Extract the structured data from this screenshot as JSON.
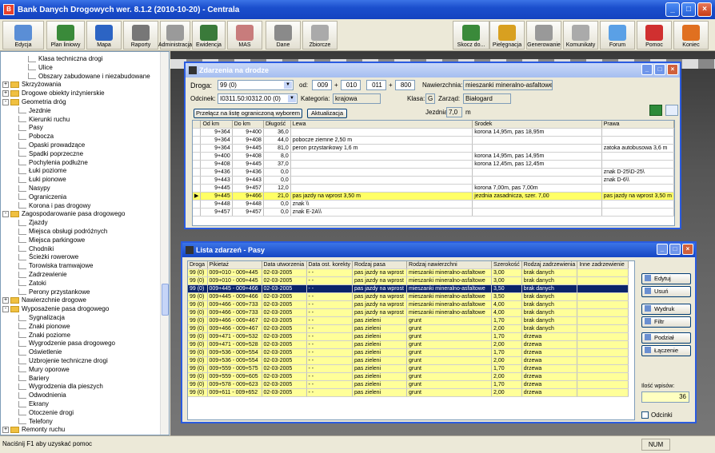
{
  "app": {
    "title": "Bank Danych Drogowych wer. 8.1.2 (2010-10-20) - Centrala",
    "icon": "app-logo-icon"
  },
  "toolbar": [
    {
      "label": "Edycja",
      "icon": "edit-icon",
      "color": "#5a8ed6"
    },
    {
      "label": "Plan liniowy",
      "icon": "linear-plan-icon",
      "color": "#3a8a3a"
    },
    {
      "label": "Mapa",
      "icon": "map-icon",
      "color": "#2c64c4"
    },
    {
      "label": "Raporty",
      "icon": "printer-icon",
      "color": "#777"
    },
    {
      "label": "Administracja",
      "icon": "admin-icon",
      "color": "#9a9a9a"
    },
    {
      "label": "Ewidencja",
      "icon": "registry-icon",
      "color": "#3a7a3a"
    },
    {
      "label": "MAS",
      "icon": "mas-icon",
      "color": "#c87c7c"
    },
    {
      "label": "Dane",
      "icon": "data-icon",
      "color": "#8a8a8a"
    },
    {
      "label": "Zbiorcze",
      "icon": "summary-icon",
      "color": "#aaa"
    },
    {
      "label": "Skocz do...",
      "icon": "jump-icon",
      "color": "#3a8a3a"
    },
    {
      "label": "Pielęgnacja",
      "icon": "maintenance-icon",
      "color": "#d8a020"
    },
    {
      "label": "Generowanie",
      "icon": "generate-icon",
      "color": "#999"
    },
    {
      "label": "Komunikaty",
      "icon": "messages-icon",
      "color": "#aaa"
    },
    {
      "label": "Forum",
      "icon": "forum-icon",
      "color": "#5aa0e6"
    },
    {
      "label": "Pomoc",
      "icon": "help-icon",
      "color": "#d03030"
    },
    {
      "label": "Koniec",
      "icon": "exit-icon",
      "color": "#e07020"
    }
  ],
  "tree": [
    {
      "t": "Klasa techniczna drogi",
      "lvl": 2
    },
    {
      "t": "Ulice",
      "lvl": 2
    },
    {
      "t": "Obszary zabudowane i niezabudowane",
      "lvl": 2
    },
    {
      "t": "Skrzyżowania",
      "lvl": 0,
      "f": 1
    },
    {
      "t": "Drogowe obiekty inżynierskie",
      "lvl": 0,
      "f": 1
    },
    {
      "t": "Geometria dróg",
      "lvl": 0,
      "f": 1,
      "o": 1
    },
    {
      "t": "Jezdnie",
      "lvl": 1
    },
    {
      "t": "Kierunki ruchu",
      "lvl": 1
    },
    {
      "t": "Pasy",
      "lvl": 1
    },
    {
      "t": "Pobocza",
      "lvl": 1
    },
    {
      "t": "Opaski prowadzące",
      "lvl": 1
    },
    {
      "t": "Spadki poprzeczne",
      "lvl": 1
    },
    {
      "t": "Pochylenia podłużne",
      "lvl": 1
    },
    {
      "t": "Łuki poziome",
      "lvl": 1
    },
    {
      "t": "Łuki pionowe",
      "lvl": 1
    },
    {
      "t": "Nasypy",
      "lvl": 1
    },
    {
      "t": "Ograniczenia",
      "lvl": 1
    },
    {
      "t": "Korona i pas drogowy",
      "lvl": 1
    },
    {
      "t": "Zagospodarowanie pasa drogowego",
      "lvl": 0,
      "f": 1,
      "o": 1
    },
    {
      "t": "Zjazdy",
      "lvl": 1
    },
    {
      "t": "Miejsca obsługi podróżnych",
      "lvl": 1
    },
    {
      "t": "Miejsca parkingowe",
      "lvl": 1
    },
    {
      "t": "Chodniki",
      "lvl": 1
    },
    {
      "t": "Ścieżki rowerowe",
      "lvl": 1
    },
    {
      "t": "Torowiska tramwajowe",
      "lvl": 1
    },
    {
      "t": "Zadrzewienie",
      "lvl": 1
    },
    {
      "t": "Zatoki",
      "lvl": 1
    },
    {
      "t": "Perony przystankowe",
      "lvl": 1
    },
    {
      "t": "Nawierzchnie drogowe",
      "lvl": 0,
      "f": 1
    },
    {
      "t": "Wyposażenie pasa drogowego",
      "lvl": 0,
      "f": 1,
      "o": 1
    },
    {
      "t": "Sygnalizacja",
      "lvl": 1
    },
    {
      "t": "Znaki pionowe",
      "lvl": 1
    },
    {
      "t": "Znaki poziome",
      "lvl": 1
    },
    {
      "t": "Wygrodzenie pasa drogowego",
      "lvl": 1
    },
    {
      "t": "Oświetlenie",
      "lvl": 1
    },
    {
      "t": "Uzbrojenie techniczne drogi",
      "lvl": 1
    },
    {
      "t": "Mury oporowe",
      "lvl": 1
    },
    {
      "t": "Bariery",
      "lvl": 1
    },
    {
      "t": "Wygrodzenia dla pieszych",
      "lvl": 1
    },
    {
      "t": "Odwodnienia",
      "lvl": 1
    },
    {
      "t": "Ekrany",
      "lvl": 1
    },
    {
      "t": "Otoczenie drogi",
      "lvl": 1
    },
    {
      "t": "Telefony",
      "lvl": 1
    },
    {
      "t": "Remonty ruchu",
      "lvl": 0,
      "f": 1
    }
  ],
  "w1": {
    "title": "Zdarzenia na drodze",
    "droga_label": "Droga:",
    "droga": "99 (0)",
    "od_label": "od:",
    "od1": "009",
    "od2": "010",
    "od3": "011",
    "od4": "800",
    "plus": "+",
    "naw_label": "Nawierzchnia:",
    "naw": "mieszanki mineralno-asfaltowe",
    "odc_label": "Odcinek:",
    "odc": "I0311.50:I0312.00 (0)",
    "kat_label": "Kategoria:",
    "kat": "krajowa",
    "klasa_label": "Klasa:",
    "klasa": "G",
    "zarz_label": "Zarząd:",
    "zarz": "Białogard",
    "btn_switch": "Przełącz na listę ograniczoną wyborem",
    "btn_update": "Aktualizacja",
    "jezdnia_label": "Jezdnia:",
    "jezdnia": "7,0",
    "jezdnia_unit": "m",
    "cols": [
      "",
      "Od km",
      "Do km",
      "Długość",
      "Lewa",
      "Środek",
      "Prawa"
    ],
    "rows": [
      [
        "9+364",
        "9+400",
        "36,0",
        "",
        "korona 14,95m, pas 18,95m",
        ""
      ],
      [
        "9+364",
        "9+408",
        "44,0",
        "pobocze ziemne 2,50 m",
        "",
        ""
      ],
      [
        "9+364",
        "9+445",
        "81,0",
        "peron przystankowy  1,6 m",
        "",
        "zatoka autobusowa 3,6 m"
      ],
      [
        "9+400",
        "9+408",
        "8,0",
        "",
        "korona 14,95m, pas 14,95m",
        ""
      ],
      [
        "9+408",
        "9+445",
        "37,0",
        "",
        "korona 12,45m, pas 12,45m",
        ""
      ],
      [
        "9+436",
        "9+436",
        "0,0",
        "",
        "",
        "znak D-25\\D-25\\"
      ],
      [
        "9+443",
        "9+443",
        "0,0",
        "",
        "",
        "znak D-6\\\\"
      ],
      [
        "9+445",
        "9+457",
        "12,0",
        "",
        "korona 7,00m, pas 7,00m",
        ""
      ],
      [
        "9+445",
        "9+466",
        "21,0",
        "pas jazdy na wprost 3,50 m",
        "jezdnia zasadnicza, szer. 7,00",
        "pas jazdy na wprost 3,50 m"
      ],
      [
        "9+448",
        "9+448",
        "0,0",
        "znak \\\\",
        "",
        ""
      ],
      [
        "9+457",
        "9+457",
        "0,0",
        "znak E-2A\\\\",
        "",
        ""
      ]
    ],
    "selected": 8
  },
  "w2": {
    "title": "Lista zdarzeń - Pasy",
    "cols": [
      "Droga",
      "Pikietaż",
      "Data utworzenia",
      "Data ost. korekty",
      "Rodzaj pasa",
      "Rodzaj nawierzchni",
      "Szerokość",
      "Rodzaj zadrzewienia",
      "Inne zadrzewienie"
    ],
    "rows": [
      [
        "99 (0)",
        "009+010 - 009+445",
        "02-03-2005",
        "- -",
        "pas jazdy na wprost",
        "mieszanki mineralno-asfaltowe",
        "3,00",
        "brak danych",
        ""
      ],
      [
        "99 (0)",
        "009+010 - 009+445",
        "02-03-2005",
        "- -",
        "pas jazdy na wprost",
        "mieszanki mineralno-asfaltowe",
        "3,00",
        "brak danych",
        ""
      ],
      [
        "99 (0)",
        "009+445 - 009+466",
        "02-03-2005",
        "- -",
        "pas jazdy na wprost",
        "mieszanki mineralno-asfaltowe",
        "3,50",
        "brak danych",
        ""
      ],
      [
        "99 (0)",
        "009+445 - 009+466",
        "02-03-2005",
        "- -",
        "pas jazdy na wprost",
        "mieszanki mineralno-asfaltowe",
        "3,50",
        "brak danych",
        ""
      ],
      [
        "99 (0)",
        "009+466 - 009+733",
        "02-03-2005",
        "- -",
        "pas jazdy na wprost",
        "mieszanki mineralno-asfaltowe",
        "4,00",
        "brak danych",
        ""
      ],
      [
        "99 (0)",
        "009+466 - 009+733",
        "02-03-2005",
        "- -",
        "pas jazdy na wprost",
        "mieszanki mineralno-asfaltowe",
        "4,00",
        "brak danych",
        ""
      ],
      [
        "99 (0)",
        "009+466 - 009+467",
        "02-03-2005",
        "- -",
        "pas zieleni",
        "grunt",
        "1,70",
        "brak danych",
        ""
      ],
      [
        "99 (0)",
        "009+466 - 009+467",
        "02-03-2005",
        "- -",
        "pas zieleni",
        "grunt",
        "2,00",
        "brak danych",
        ""
      ],
      [
        "99 (0)",
        "009+471 - 009+532",
        "02-03-2005",
        "- -",
        "pas zieleni",
        "grunt",
        "1,70",
        "drzewa",
        ""
      ],
      [
        "99 (0)",
        "009+471 - 009+528",
        "02-03-2005",
        "- -",
        "pas zieleni",
        "grunt",
        "2,00",
        "drzewa",
        ""
      ],
      [
        "99 (0)",
        "009+536 - 009+554",
        "02-03-2005",
        "- -",
        "pas zieleni",
        "grunt",
        "1,70",
        "drzewa",
        ""
      ],
      [
        "99 (0)",
        "009+536 - 009+554",
        "02-03-2005",
        "- -",
        "pas zieleni",
        "grunt",
        "2,00",
        "drzewa",
        ""
      ],
      [
        "99 (0)",
        "009+559 - 009+575",
        "02-03-2005",
        "- -",
        "pas zieleni",
        "grunt",
        "1,70",
        "drzewa",
        ""
      ],
      [
        "99 (0)",
        "009+559 - 009+605",
        "02-03-2005",
        "- -",
        "pas zieleni",
        "grunt",
        "2,00",
        "drzewa",
        ""
      ],
      [
        "99 (0)",
        "009+578 - 009+623",
        "02-03-2005",
        "- -",
        "pas zieleni",
        "grunt",
        "1,70",
        "drzewa",
        ""
      ],
      [
        "99 (0)",
        "009+611 - 009+652",
        "02-03-2005",
        "- -",
        "pas zieleni",
        "grunt",
        "2,00",
        "drzewa",
        ""
      ]
    ],
    "selected": 2,
    "buttons": [
      {
        "label": "Edytuj",
        "icon": "edit-icon"
      },
      {
        "label": "Usuń",
        "icon": "delete-icon"
      },
      {
        "label": "Wydruk",
        "icon": "print-icon"
      },
      {
        "label": "Filtr",
        "icon": "filter-icon"
      },
      {
        "label": "Podział",
        "icon": "split-icon"
      },
      {
        "label": "Łączenie",
        "icon": "merge-icon"
      }
    ],
    "count_label": "Ilość wpisów:",
    "count": "36",
    "odcinki": "Odcinki"
  },
  "status": {
    "text": "Naciśnij F1 aby uzyskać pomoc",
    "num": "NUM"
  },
  "colors": {
    "yellow_row": "#ffff99",
    "highlight_row": "#ffff66",
    "selected_row": "#0a246a",
    "title_blue": "#1646c4"
  }
}
